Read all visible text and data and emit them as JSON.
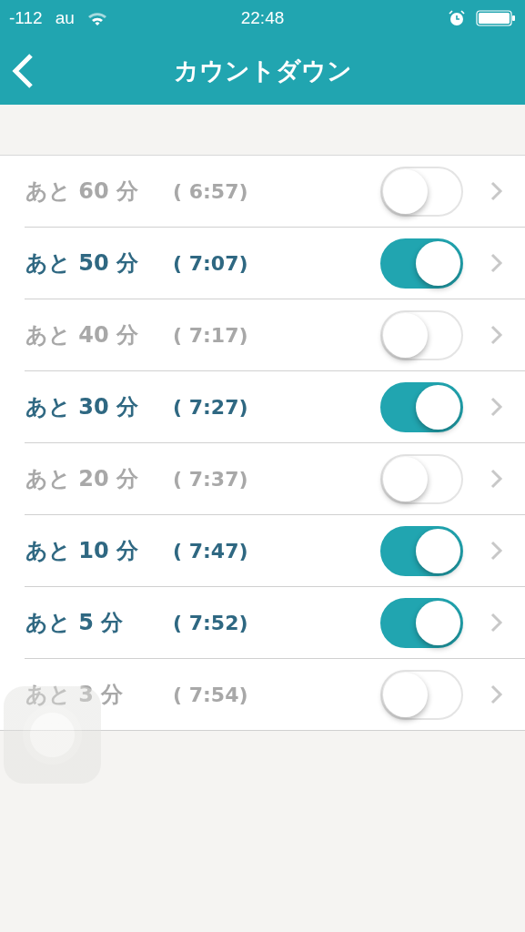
{
  "status_bar": {
    "signal": "-112",
    "carrier": "au",
    "time": "22:48"
  },
  "nav": {
    "title": "カウントダウン"
  },
  "rows": [
    {
      "label": "あと 60 分",
      "time": "( 6:57)",
      "on": false
    },
    {
      "label": "あと 50 分",
      "time": "( 7:07)",
      "on": true
    },
    {
      "label": "あと 40 分",
      "time": "( 7:17)",
      "on": false
    },
    {
      "label": "あと 30 分",
      "time": "( 7:27)",
      "on": true
    },
    {
      "label": "あと 20 分",
      "time": "( 7:37)",
      "on": false
    },
    {
      "label": "あと 10 分",
      "time": "( 7:47)",
      "on": true
    },
    {
      "label": "あと 5 分",
      "time": "( 7:52)",
      "on": true
    },
    {
      "label": "あと 3 分",
      "time": "( 7:54)",
      "on": false
    }
  ]
}
